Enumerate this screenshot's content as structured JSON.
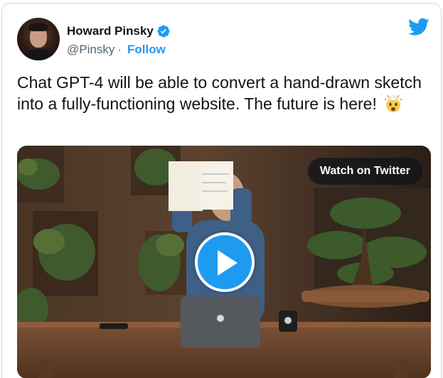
{
  "author": {
    "display_name": "Howard Pinsky",
    "handle": "@Pinsky",
    "separator": "·",
    "follow_label": "Follow",
    "verified": true
  },
  "tweet": {
    "text": "Chat GPT-4 will be able to convert a hand-drawn sketch into a fully-functioning website. The future is here!",
    "emoji": "exploding-head"
  },
  "media": {
    "watch_label": "Watch on Twitter",
    "play_icon": "play-icon"
  },
  "colors": {
    "brand_blue": "#1d9bf0",
    "text_primary": "#0f1419",
    "text_secondary": "#536471"
  },
  "icons": [
    "verified-badge-icon",
    "twitter-bird-icon",
    "exploding-head-emoji-icon",
    "play-icon"
  ]
}
